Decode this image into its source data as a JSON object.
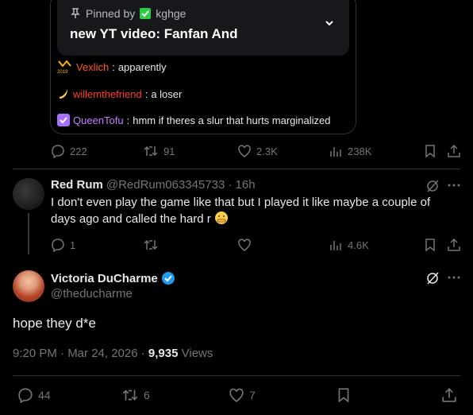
{
  "pinned": {
    "label": "Pinned by",
    "user": "kghge",
    "title": "new YT video: Fanfan And"
  },
  "chat": [
    {
      "user": "Vexlich",
      "sep": ":",
      "text": "apparently",
      "badge": "2019",
      "color": "#ff5a1f"
    },
    {
      "user": "willemthefriend",
      "sep": ":",
      "text": "a loser",
      "color": "#ff3b30"
    },
    {
      "user": "QueenTofu",
      "sep": ":",
      "text": "hmm if theres a slur that hurts marginalized",
      "color": "#c77dff"
    }
  ],
  "post1_actions": {
    "replies": "222",
    "reposts": "91",
    "likes": "2.3K",
    "views": "238K"
  },
  "reply": {
    "name": "Red Rum",
    "handle": "@RedRum063345733",
    "time": "· 16h",
    "text": "I don't even play the game like that but I played it like maybe a couple of days ago and called the hard r",
    "actions": {
      "replies": "1",
      "reposts": "",
      "likes": "",
      "views": "4.6K"
    }
  },
  "main": {
    "name": "Victoria DuCharme",
    "handle": "@theducharme",
    "text": "hope they d*e",
    "timestamp": "9:20 PM · Mar 24, 2026 · ",
    "views_count": "9,935",
    "views_label": " Views",
    "actions": {
      "replies": "44",
      "reposts": "6",
      "likes": "7"
    }
  },
  "colors": {
    "accent": "#1d9bf0",
    "verified": "#1d9bf0",
    "muted": "#71767b"
  }
}
